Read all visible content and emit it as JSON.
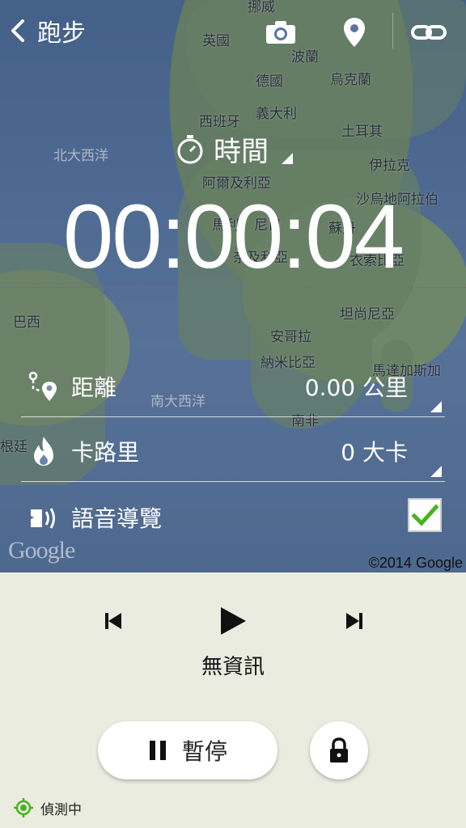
{
  "app": {
    "title": "跑步"
  },
  "map": {
    "labels": {
      "norway": "挪威",
      "uk": "英國",
      "poland": "波蘭",
      "germany": "德國",
      "ukraine": "烏克蘭",
      "spain": "西班牙",
      "italy": "義大利",
      "turkey": "土耳其",
      "north_atlantic": "北大西洋",
      "iraq": "伊拉克",
      "algeria": "阿爾及利亞",
      "saudi": "沙烏地阿拉伯",
      "mali": "馬利",
      "niger": "尼日",
      "sudan": "蘇丹",
      "nigeria": "奈及利亞",
      "ethiopia": "衣索比亞",
      "brazil": "巴西",
      "tanzania": "坦尚尼亞",
      "angola": "安哥拉",
      "namibia": "納米比亞",
      "madagascar": "馬達加斯加",
      "south_atlantic": "南大西洋",
      "south_africa": "南非",
      "argentina": "根廷"
    },
    "google_logo": "Google",
    "copyright": "©2014 Google"
  },
  "metric": {
    "label": "時間",
    "timer": "00:00:04"
  },
  "rows": [
    {
      "label": "距離",
      "value": "0.00 公里"
    },
    {
      "label": "卡路里",
      "value": "0 大卡"
    },
    {
      "label": "語音導覽",
      "checked": true
    }
  ],
  "player": {
    "track": "無資訊"
  },
  "controls": {
    "pause_label": "暫停"
  },
  "status": {
    "gps": "偵測中"
  },
  "colors": {
    "accent_green": "#46b320",
    "panel_bg": "#e9ecdf"
  }
}
